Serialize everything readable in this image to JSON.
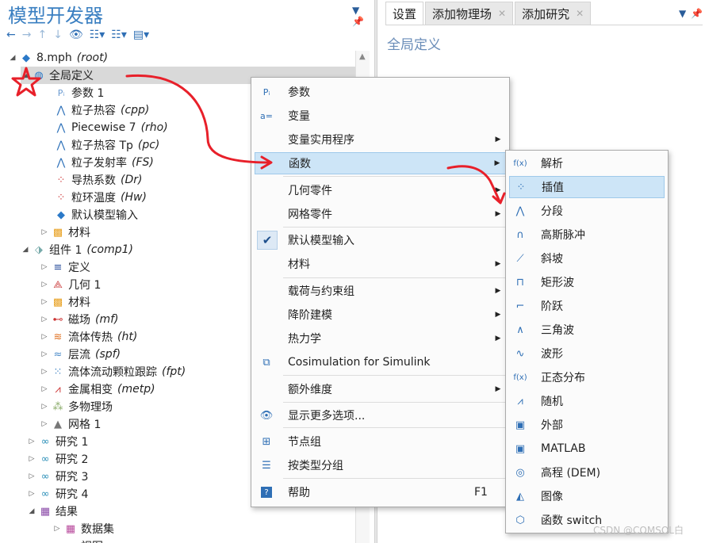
{
  "left_panel": {
    "title": "模型开发器",
    "tree": [
      {
        "label": "8.mph",
        "tag": "(root)",
        "icon": "file-icon"
      },
      {
        "label": "全局定义",
        "tag": "",
        "icon": "globe-icon"
      },
      {
        "label": "参数 1",
        "tag": "",
        "icon": "parameter-icon"
      },
      {
        "label": "粒子热容",
        "tag": "(cpp)",
        "icon": "piecewise-function-icon"
      },
      {
        "label": "Piecewise 7",
        "tag": "(rho)",
        "icon": "piecewise-function-icon"
      },
      {
        "label": "粒子热容 Tp",
        "tag": "(pc)",
        "icon": "piecewise-function-icon"
      },
      {
        "label": "粒子发射率",
        "tag": "(FS)",
        "icon": "piecewise-function-icon"
      },
      {
        "label": "导热系数",
        "tag": "(Dr)",
        "icon": "interpolation-function-icon"
      },
      {
        "label": "粒环温度",
        "tag": "(Hw)",
        "icon": "interpolation-function-icon"
      },
      {
        "label": "默认模型输入",
        "tag": "",
        "icon": "model-input-icon"
      },
      {
        "label": "材料",
        "tag": "",
        "icon": "materials-icon"
      },
      {
        "label": "组件 1",
        "tag": "(comp1)",
        "icon": "component-icon"
      },
      {
        "label": "定义",
        "tag": "",
        "icon": "definitions-icon"
      },
      {
        "label": "几何 1",
        "tag": "",
        "icon": "geometry-icon"
      },
      {
        "label": "材料",
        "tag": "",
        "icon": "materials-icon"
      },
      {
        "label": "磁场",
        "tag": "(mf)",
        "icon": "magnetic-field-icon"
      },
      {
        "label": "流体传热",
        "tag": "(ht)",
        "icon": "heat-transfer-icon"
      },
      {
        "label": "层流",
        "tag": "(spf)",
        "icon": "laminar-flow-icon"
      },
      {
        "label": "流体流动颗粒跟踪",
        "tag": "(fpt)",
        "icon": "particle-tracing-icon"
      },
      {
        "label": "金属相变",
        "tag": "(metp)",
        "icon": "phase-transformation-icon"
      },
      {
        "label": "多物理场",
        "tag": "",
        "icon": "multiphysics-icon"
      },
      {
        "label": "网格 1",
        "tag": "",
        "icon": "mesh-icon"
      },
      {
        "label": "研究 1",
        "tag": "",
        "icon": "study-icon"
      },
      {
        "label": "研究 2",
        "tag": "",
        "icon": "study-icon"
      },
      {
        "label": "研究 3",
        "tag": "",
        "icon": "study-icon"
      },
      {
        "label": "研究 4",
        "tag": "",
        "icon": "study-icon"
      },
      {
        "label": "结果",
        "tag": "",
        "icon": "results-icon"
      },
      {
        "label": "数据集",
        "tag": "",
        "icon": "datasets-icon"
      },
      {
        "label": "视图",
        "tag": "",
        "icon": "views-icon"
      }
    ]
  },
  "right_panel": {
    "tabs": [
      {
        "label": "设置",
        "closable": false
      },
      {
        "label": "添加物理场",
        "closable": true
      },
      {
        "label": "添加研究",
        "closable": true
      }
    ],
    "settings_title": "全局定义"
  },
  "context_menu": {
    "items": [
      {
        "label": "参数",
        "icon": "parameter-icon",
        "submenu": false,
        "shortcut": ""
      },
      {
        "label": "变量",
        "icon": "variable-icon",
        "submenu": false,
        "shortcut": ""
      },
      {
        "label": "变量实用程序",
        "icon": "",
        "submenu": true,
        "shortcut": ""
      },
      {
        "label": "函数",
        "icon": "",
        "submenu": true,
        "shortcut": "",
        "highlighted": true
      },
      {
        "label": "几何零件",
        "icon": "",
        "submenu": true,
        "shortcut": ""
      },
      {
        "label": "网格零件",
        "icon": "",
        "submenu": true,
        "shortcut": ""
      },
      {
        "label": "默认模型输入",
        "icon": "check-icon",
        "submenu": false,
        "shortcut": "",
        "checked": true
      },
      {
        "label": "材料",
        "icon": "",
        "submenu": true,
        "shortcut": ""
      },
      {
        "label": "载荷与约束组",
        "icon": "",
        "submenu": true,
        "shortcut": ""
      },
      {
        "label": "降阶建模",
        "icon": "",
        "submenu": true,
        "shortcut": ""
      },
      {
        "label": "热力学",
        "icon": "",
        "submenu": true,
        "shortcut": ""
      },
      {
        "label": "Cosimulation for Simulink",
        "icon": "cosimulation-icon",
        "submenu": false,
        "shortcut": ""
      },
      {
        "label": "额外维度",
        "icon": "",
        "submenu": true,
        "shortcut": ""
      },
      {
        "label": "显示更多选项...",
        "icon": "eye-icon",
        "submenu": false,
        "shortcut": ""
      },
      {
        "label": "节点组",
        "icon": "node-group-icon",
        "submenu": false,
        "shortcut": ""
      },
      {
        "label": "按类型分组",
        "icon": "group-by-type-icon",
        "submenu": false,
        "shortcut": ""
      },
      {
        "label": "帮助",
        "icon": "help-icon",
        "submenu": false,
        "shortcut": "F1"
      }
    ]
  },
  "functions_submenu": {
    "items": [
      {
        "label": "解析",
        "icon": "analytic-function-icon"
      },
      {
        "label": "插值",
        "icon": "interpolation-function-icon",
        "highlighted": true
      },
      {
        "label": "分段",
        "icon": "piecewise-function-icon"
      },
      {
        "label": "高斯脉冲",
        "icon": "gaussian-pulse-icon"
      },
      {
        "label": "斜坡",
        "icon": "ramp-icon"
      },
      {
        "label": "矩形波",
        "icon": "rectangle-wave-icon"
      },
      {
        "label": "阶跃",
        "icon": "step-icon"
      },
      {
        "label": "三角波",
        "icon": "triangle-wave-icon"
      },
      {
        "label": "波形",
        "icon": "waveform-icon"
      },
      {
        "label": "正态分布",
        "icon": "normal-distribution-icon"
      },
      {
        "label": "随机",
        "icon": "random-icon"
      },
      {
        "label": "外部",
        "icon": "external-icon"
      },
      {
        "label": "MATLAB",
        "icon": "matlab-icon"
      },
      {
        "label": "高程 (DEM)",
        "icon": "elevation-icon"
      },
      {
        "label": "图像",
        "icon": "image-icon"
      },
      {
        "label": "函数 switch",
        "icon": "switch-icon"
      }
    ]
  },
  "watermark": "CSDN @COMSOL白",
  "colors": {
    "accent": "#3a7fc1",
    "highlight": "#cde5f7",
    "annotation": "#e8202a"
  }
}
